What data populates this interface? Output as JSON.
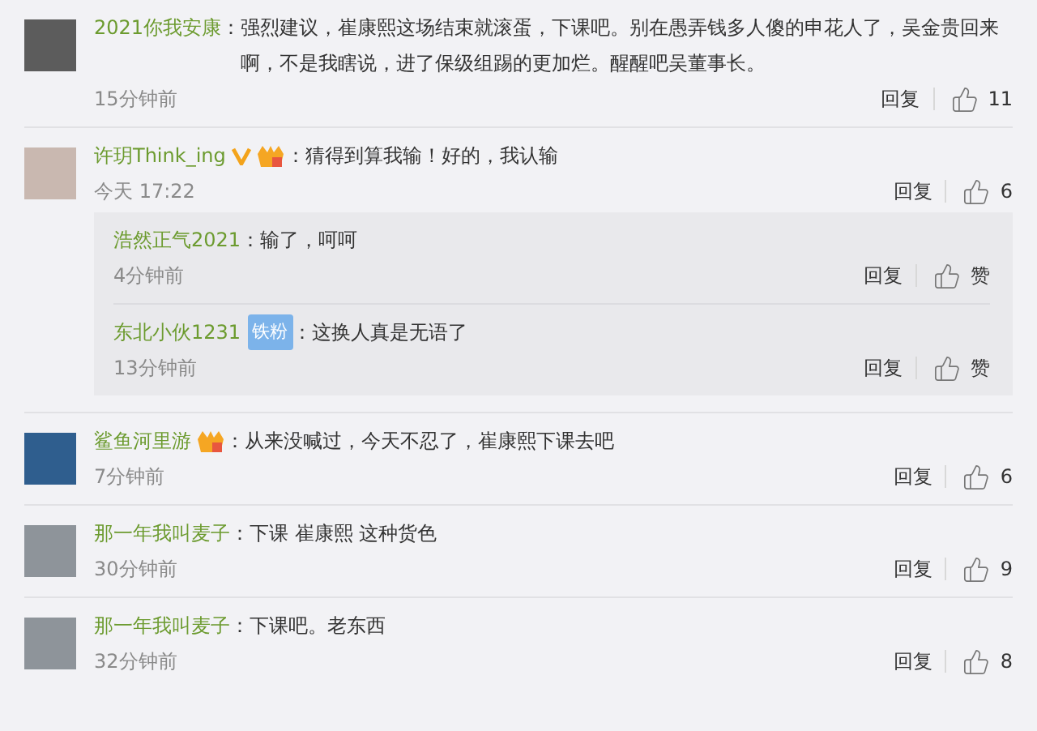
{
  "comments": [
    {
      "name": "2021你我安康",
      "sep": "：",
      "text": "强烈建议，崔康熙这场结束就滚蛋，下课吧。别在愚弄钱多人傻的申花人了，吴金贵回来啊，不是我瞎说，进了保级组踢的更加烂。醒醒吧吴董事长。",
      "time": "15分钟前",
      "reply": "回复",
      "like": "11"
    },
    {
      "name": "许玥Think_ing",
      "badges": [
        {
          "kind": "verified"
        },
        {
          "kind": "fan-icon"
        }
      ],
      "sep": "：",
      "text": "猜得到算我输！好的，我认输",
      "time": "今天 17:22",
      "reply": "回复",
      "like": "6",
      "replies": [
        {
          "name": "浩然正气2021",
          "sep": "：",
          "text": "输了，呵呵",
          "time": "4分钟前",
          "reply": "回复",
          "like": "赞"
        },
        {
          "name": "东北小伙1231",
          "badges": [
            {
              "kind": "label",
              "text": "铁粉"
            }
          ],
          "sep": "：",
          "text": "这换人真是无语了",
          "time": "13分钟前",
          "reply": "回复",
          "like": "赞"
        }
      ]
    },
    {
      "name": "鲨鱼河里游",
      "badges": [
        {
          "kind": "fan-icon"
        }
      ],
      "sep": "：",
      "text": "从来没喊过，今天不忍了，崔康熙下课去吧",
      "time": "7分钟前",
      "reply": "回复",
      "like": "6"
    },
    {
      "name": "那一年我叫麦子",
      "sep": "：",
      "text": "下课 崔康熙 这种货色",
      "time": "30分钟前",
      "reply": "回复",
      "like": "9"
    },
    {
      "name": "那一年我叫麦子",
      "sep": "：",
      "text": "下课吧。老东西",
      "time": "32分钟前",
      "reply": "回复",
      "like": "8"
    }
  ]
}
